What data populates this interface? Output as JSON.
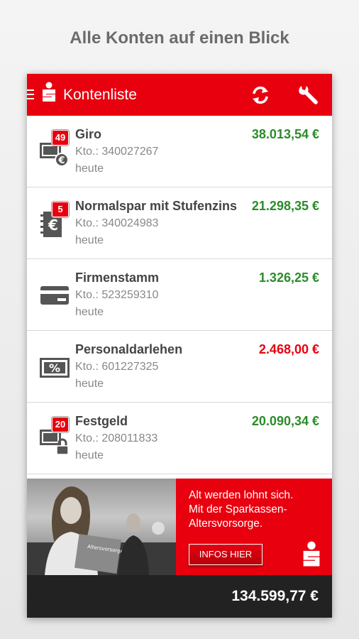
{
  "headline": "Alle Konten auf einen Blick",
  "appbar": {
    "title": "Kontenliste",
    "icons": [
      "menu-icon",
      "sparkasse-logo-icon",
      "refresh-icon",
      "wrench-icon"
    ]
  },
  "accounts": [
    {
      "name": "Giro",
      "number": "Kto.: 340027267",
      "date": "heute",
      "amount": "38.013,54 €",
      "badge": "49",
      "icon": "cash-euro-icon",
      "sign": "positive"
    },
    {
      "name": "Normalspar mit Stufenzins",
      "number": "Kto.: 340024983",
      "date": "heute",
      "amount": "21.298,35 €",
      "badge": "5",
      "icon": "savings-book-icon",
      "sign": "positive"
    },
    {
      "name": "Firmenstamm",
      "number": "Kto.: 523259310",
      "date": "heute",
      "amount": "1.326,25 €",
      "badge": "",
      "icon": "card-icon",
      "sign": "positive"
    },
    {
      "name": "Personaldarlehen",
      "number": "Kto.: 601227325",
      "date": "heute",
      "amount": "2.468,00 €",
      "badge": "",
      "icon": "loan-percent-icon",
      "sign": "negative"
    },
    {
      "name": "Festgeld",
      "number": "Kto.: 208011833",
      "date": "heute",
      "amount": "20.090,34 €",
      "badge": "20",
      "icon": "cash-lock-icon",
      "sign": "positive"
    }
  ],
  "ad": {
    "text": "Alt werden lohnt sich.\nMit der Sparkassen-\nAltersvorsorge.",
    "cta": "INFOS HIER",
    "book_label": "Altersvorsorge"
  },
  "footer": {
    "total": "134.599,77 €"
  },
  "colors": {
    "brand": "#e8000f",
    "positive": "#2a8c2a",
    "negative": "#e8000f",
    "footer": "#222222"
  }
}
